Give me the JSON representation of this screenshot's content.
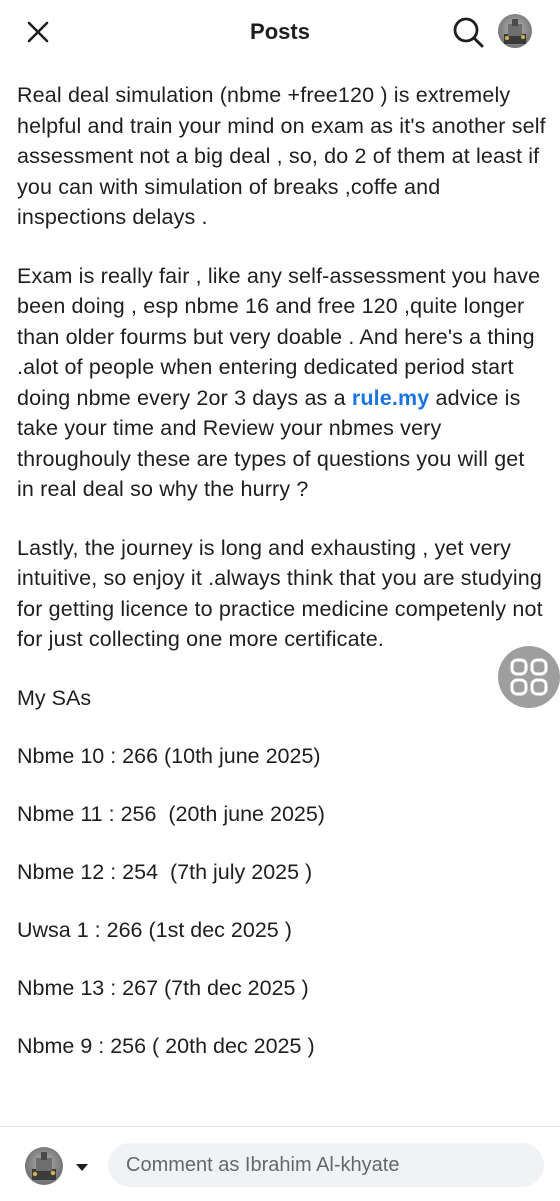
{
  "header": {
    "title": "Posts",
    "icons": {
      "close": "close-icon",
      "search": "search-icon"
    }
  },
  "post": {
    "para1": "Real deal simulation (nbme +free120 ) is extremely helpful and train your mind on exam as it's another self assessment not a big deal , so, do 2 of them at least if you can with simulation of breaks ,coffe and inspections delays .",
    "para2_before": "Exam is really fair , like any self-assessment you have been doing , esp nbme 16 and free 120 ,quite longer than older fourms but very doable . And here's a thing .alot of people when entering dedicated period start doing nbme every 2or 3 days as a ",
    "para2_link": "rule.my",
    "para2_after": " advice is take your time and Review your nbmes very throughouly these are types of questions you will get in real deal so why the hurry ?",
    "para3": "Lastly, the journey is long and exhausting , yet very intuitive, so enjoy it .always think that you are studying for getting licence to practice medicine competenly not for just collecting one more certificate.",
    "sas_heading": "My SAs",
    "scores": [
      "Nbme 10 : 266 (10th june 2025)",
      "Nbme 11 : 256  (20th june 2025)",
      "Nbme 12 : 254  (7th july 2025 )",
      "Uwsa 1 : 266 (1st dec 2025 )",
      "Nbme 13 : 267 (7th dec 2025 )",
      "Nbme 9 : 256 ( 20th dec 2025 )"
    ]
  },
  "footer": {
    "comment_placeholder": "Comment as Ibrahim Al-khyate",
    "icons": {
      "caret": "caret-down-icon"
    }
  },
  "colors": {
    "link": "#1b74e4",
    "text": "#1c1e21",
    "input_bg": "#f0f2f5",
    "floating_button": "#8e8e8e"
  }
}
